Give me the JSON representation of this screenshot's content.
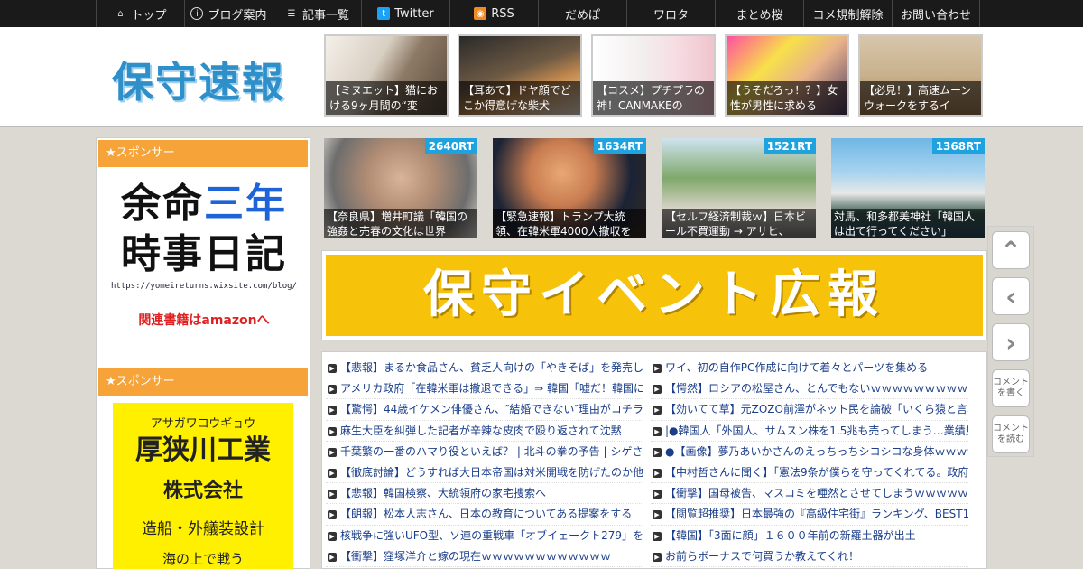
{
  "nav": [
    {
      "label": "トップ",
      "icon": "home-icon"
    },
    {
      "label": "ブログ案内",
      "icon": "info-icon"
    },
    {
      "label": "記事一覧",
      "icon": "list-icon"
    },
    {
      "label": "Twitter",
      "icon": "twitter-icon"
    },
    {
      "label": "RSS",
      "icon": "rss-icon"
    },
    {
      "label": "だめぽ",
      "icon": ""
    },
    {
      "label": "ワロタ",
      "icon": ""
    },
    {
      "label": "まとめ桜",
      "icon": ""
    },
    {
      "label": "コメ規制解除",
      "icon": ""
    },
    {
      "label": "お問い合わせ",
      "icon": ""
    }
  ],
  "header": {
    "logo": "保守速報",
    "thumbs": [
      "【ミヌエット】猫における9ヶ月間の“変",
      "【耳あて】ドヤ顔でどこか得意げな柴犬",
      "【コスメ】プチプラの神！CANMAKEの",
      "【うそだろっ！？】女性が男性に求める",
      "【必見！】高速ムーンウォークをするイ"
    ]
  },
  "sidebar": {
    "sponsor1": "★スポンサー",
    "ad1": {
      "line1a": "余命",
      "line1b": "三年",
      "line2": "時事日記",
      "url": "https://yomeireturns.wixsite.com/blog/",
      "amazon": "関連書籍はamazonへ"
    },
    "sponsor2": "★スポンサー",
    "ad2": {
      "kana": "アサガワコウギョウ",
      "name": "厚狭川工業",
      "kk": "株式会社",
      "biz": "造船・外艤装設計",
      "more": "海の上で戦う"
    }
  },
  "ranking": [
    {
      "rt": "2640RT",
      "caption": "【奈良県】増井町議「韓国の強姦と売春の文化は世界"
    },
    {
      "rt": "1634RT",
      "caption": "【緊急速報】トランプ大統領、在韓米軍4000人撤収を"
    },
    {
      "rt": "1521RT",
      "caption": "【セルフ経済制裁ｗ】日本ビール不買運動 → アサヒ、"
    },
    {
      "rt": "1368RT",
      "caption": "対馬、和多都美神社「韓国人は出て行ってください」"
    }
  ],
  "banner": {
    "text": "保守イベント広報"
  },
  "news_left": [
    "【悲報】まるか食品さん、貧乏人向けの「やきそば」を発売し",
    "アメリカ政府「在韓米軍は撤退できる」⇒ 韓国「嘘だ！韓国に",
    "【驚愕】44歳イケメン俳優さん、″結婚できない″理由がコチラ",
    "麻生大臣を糾弾した記者が辛辣な皮肉で殴り返されて沈黙",
    "千葉繁の一番のハマり役といえば？ | 北斗の拳の予告 | シゲさん",
    "【徹底討論】どうすれば大日本帝国は対米開戦を防げたのか他",
    "【悲報】韓国検察、大統領府の家宅捜索へ",
    "【朗報】松本人志さん、日本の教育についてある提案をする",
    "核戦争に強いUFO型、ソ連の重戦車「オブイェークト279」を公",
    "【衝撃】窪塚洋介と嫁の現在ｗｗｗｗｗｗｗｗｗｗｗｗ"
  ],
  "news_right": [
    "ワイ、初の自作PC作成に向けて着々とパーツを集める",
    "【愕然】ロシアの松屋さん、とんでもないｗｗｗｗｗｗｗｗｗ",
    "【効いてて草】元ZOZO前澤がネット民を論破「いくら猿と言わ",
    "|●韓国人「外国人、サムスン株を1.5兆も売ってしまう…業績見",
    "●【画像】夢乃あいかさんのえっちっちシコシコな身体ｗｗｗｗ",
    "【中村哲さんに聞く】「憲法9条が僕らを守ってくれてる。政府",
    "【衝撃】国母被告、マスコミを唖然とさせてしまうｗｗｗｗｗｗ",
    "【閲覧超推奨】日本最強の『高級住宅街』ランキング、BEST1",
    "【韓国】「3面に顔」１６００年前の新羅土器が出土",
    "お前らボーナスで何買うか教えてくれ！"
  ],
  "floatbar": {
    "comment_write": "コメントを書く",
    "comment_read": "コメントを読む"
  }
}
